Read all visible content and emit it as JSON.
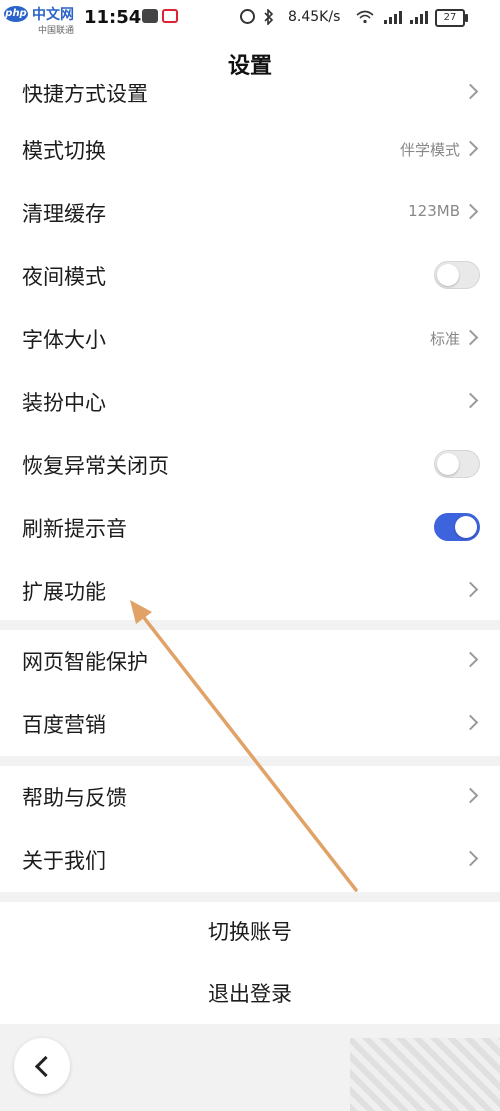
{
  "status_bar": {
    "site_badge": "php",
    "site_name": "中文网",
    "carrier": "中国联通",
    "time": "11:54",
    "network_speed": "8.45K/s",
    "battery": "27"
  },
  "header": {
    "title": "设置"
  },
  "settings_group_1": {
    "items": [
      {
        "label": "快捷方式设置"
      },
      {
        "label": "模式切换",
        "value": "伴学模式"
      },
      {
        "label": "清理缓存",
        "value": "123MB"
      },
      {
        "label": "夜间模式",
        "toggle": false
      },
      {
        "label": "字体大小",
        "value": "标准"
      },
      {
        "label": "装扮中心"
      },
      {
        "label": "恢复异常关闭页",
        "toggle": false
      },
      {
        "label": "刷新提示音",
        "toggle": true
      },
      {
        "label": "扩展功能"
      }
    ]
  },
  "settings_group_2": {
    "items": [
      {
        "label": "网页智能保护"
      },
      {
        "label": "百度营销"
      }
    ]
  },
  "settings_group_3": {
    "items": [
      {
        "label": "帮助与反馈"
      },
      {
        "label": "关于我们"
      }
    ]
  },
  "account": {
    "switch_account": "切换账号",
    "logout": "退出登录"
  },
  "colors": {
    "accent": "#3d63dd",
    "annotation_arrow": "#e0a266"
  }
}
